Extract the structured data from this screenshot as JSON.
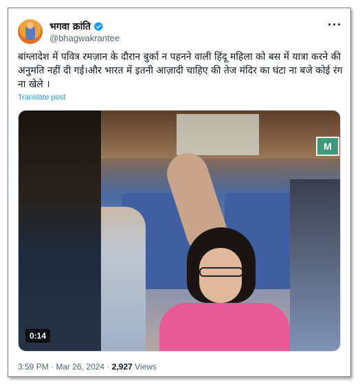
{
  "author": {
    "display_name": "भगवा क्रांति",
    "handle": "@bhagwakrantee",
    "verified_icon": "verified-badge-icon",
    "verified_color": "#1d9bf0"
  },
  "post": {
    "text": "बांग्लादेश में पवित्र रमज़ान के दौरान बुर्का न पहनने वाली हिंदू महिला को बस में यात्रा करने की अनुमति नहीं दी गई।और भारत में इतनी आज़ादी चाहिए की तेज मंदिर का घंटा ना बजे कोई रंग ना खेले ।",
    "translate_label": "Translate post"
  },
  "video": {
    "duration": "0:14"
  },
  "meta": {
    "time": "3:59 PM",
    "separator": " · ",
    "date": "Mar 26, 2024",
    "views_count": "2,927",
    "views_label": " Views"
  },
  "more_icon": "more-dots-icon",
  "colors": {
    "link": "#1d9bf0",
    "muted": "#536471",
    "text": "#0f1419"
  }
}
